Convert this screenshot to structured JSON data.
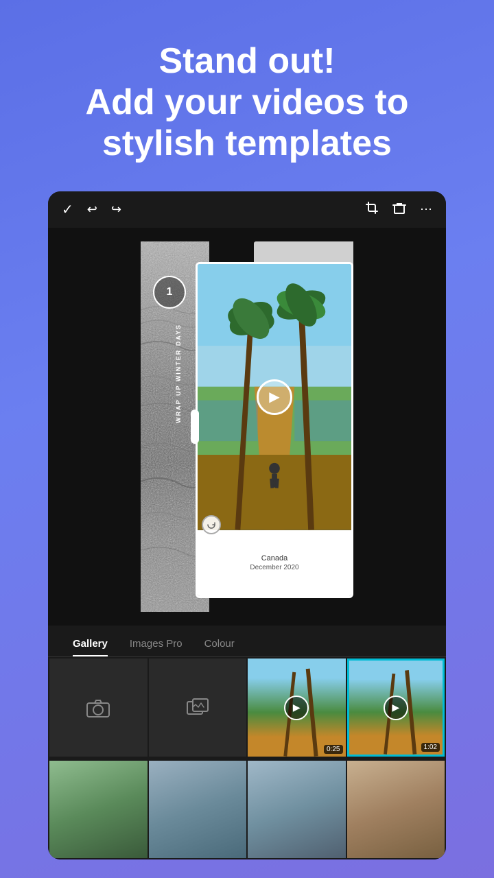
{
  "header": {
    "line1": "Stand out!",
    "line2": "Add your videos to",
    "line3": "stylish templates"
  },
  "toolbar": {
    "confirm": "✓",
    "undo": "↩",
    "redo": "↪",
    "crop": "⊡",
    "delete": "🗑",
    "more": "⋯"
  },
  "template": {
    "badge_number": "1",
    "vertical_text": "WRAP UP WINTER DAYS",
    "location": "Canada",
    "date": "December 2020"
  },
  "tabs": [
    {
      "id": "gallery",
      "label": "Gallery",
      "active": true
    },
    {
      "id": "images-pro",
      "label": "Images Pro",
      "active": false
    },
    {
      "id": "colour",
      "label": "Colour",
      "active": false
    }
  ],
  "media_items": [
    {
      "type": "camera",
      "label": ""
    },
    {
      "type": "gallery",
      "label": ""
    },
    {
      "type": "video",
      "duration": "0:25",
      "has_play": true,
      "selected": false
    },
    {
      "type": "video",
      "duration": "1:02",
      "has_play": true,
      "selected": true
    },
    {
      "type": "photo",
      "selected": false
    },
    {
      "type": "photo",
      "selected": false
    },
    {
      "type": "photo",
      "selected": false
    },
    {
      "type": "photo",
      "selected": false
    }
  ],
  "icons": {
    "camera": "📷",
    "image": "🖼",
    "play": "▶"
  }
}
